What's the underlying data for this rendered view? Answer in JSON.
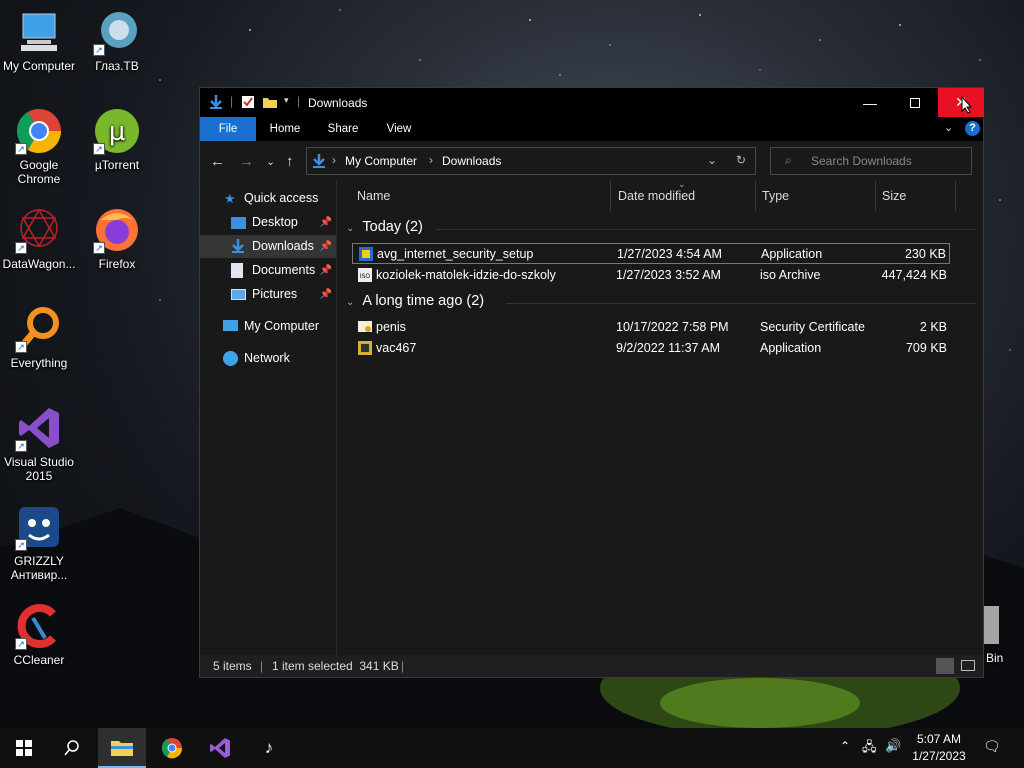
{
  "desktop": {
    "icons": [
      {
        "label": "My Computer"
      },
      {
        "label": "Глаз.ТВ"
      },
      {
        "label": "Google Chrome"
      },
      {
        "label": "µTorrent"
      },
      {
        "label": "DataWagon..."
      },
      {
        "label": "Firefox"
      },
      {
        "label": "Everything"
      },
      {
        "label": "Visual Studio 2015"
      },
      {
        "label": "GRIZZLY Антивир..."
      },
      {
        "label": "CCleaner"
      }
    ],
    "recycle_bin_partial": "e Bin"
  },
  "window": {
    "title": "Downloads",
    "ribbon_tabs": [
      "File",
      "Home",
      "Share",
      "View"
    ],
    "address": {
      "crumbs": [
        "My Computer",
        "Downloads"
      ]
    },
    "search_placeholder": "Search Downloads",
    "nav": {
      "quick_access": "Quick access",
      "items": [
        "Desktop",
        "Downloads",
        "Documents",
        "Pictures"
      ],
      "my_computer": "My Computer",
      "network": "Network"
    },
    "columns": [
      "Name",
      "Date modified",
      "Type",
      "Size"
    ],
    "groups": [
      {
        "label": "Today (2)",
        "files": [
          {
            "name": "avg_internet_security_setup",
            "date": "1/27/2023 4:54 AM",
            "type": "Application",
            "size": "230 KB"
          },
          {
            "name": "koziolek-matolek-idzie-do-szkoly",
            "date": "1/27/2023 3:52 AM",
            "type": "iso Archive",
            "size": "447,424 KB"
          }
        ]
      },
      {
        "label": "A long time ago (2)",
        "files": [
          {
            "name": "penis",
            "date": "10/17/2022 7:58 PM",
            "type": "Security Certificate",
            "size": "2 KB"
          },
          {
            "name": "vac467",
            "date": "9/2/2022 11:37 AM",
            "type": "Application",
            "size": "709 KB"
          }
        ]
      }
    ],
    "status": {
      "items": "5 items",
      "selected": "1 item selected  341 KB"
    }
  },
  "taskbar": {
    "time": "5:07 AM",
    "date": "1/27/2023"
  },
  "colors": {
    "accent": "#1a6fd1",
    "close": "#e81123"
  }
}
